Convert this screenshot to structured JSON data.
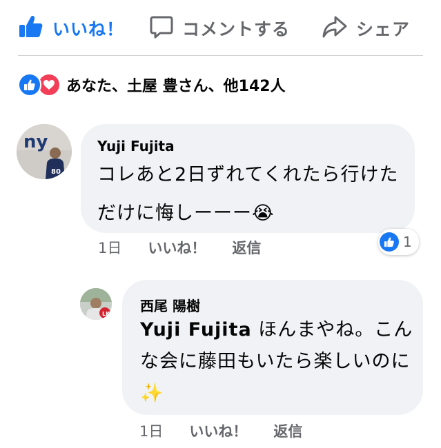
{
  "actions": {
    "like_label": "いいね！",
    "comment_label": "コメントする",
    "share_label": "シェア"
  },
  "reactions": {
    "summary": "あなた、土屋 豊さん、他142人"
  },
  "comments": [
    {
      "author": "Yuji Fujita",
      "text": "コレあと2日ずれてくれたら行けただけに悔しーーー",
      "emoji": "😭",
      "time": "1日",
      "like_label": "いいね！",
      "reply_label": "返信",
      "reaction_count": "1"
    }
  ],
  "replies": [
    {
      "author": "西尾 陽樹",
      "mention": "Yuji Fujita",
      "text": " ほんまやね。こんな会に藤田もいたら楽しいのに",
      "emoji": "✨",
      "time": "1日",
      "like_label": "いいね！",
      "reply_label": "返信"
    }
  ],
  "colors": {
    "accent": "#1877f2",
    "love": "#f33e58",
    "bubble": "#f0f2f5",
    "muted": "#65676b"
  }
}
